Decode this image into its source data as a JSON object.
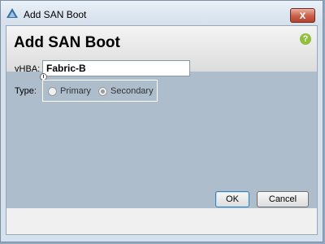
{
  "window": {
    "title": "Add SAN Boot",
    "close_label": "x"
  },
  "dialog": {
    "heading": "Add SAN Boot",
    "help_symbol": "?"
  },
  "form": {
    "vhba_label": "vHBA:",
    "vhba_value": "Fabric-B",
    "info_symbol": "i",
    "type_label": "Type:",
    "type_options": [
      {
        "label": "Primary",
        "selected": false
      },
      {
        "label": "Secondary",
        "selected": true
      }
    ]
  },
  "buttons": {
    "ok": "OK",
    "cancel": "Cancel"
  },
  "colors": {
    "panel": "#aebdcb",
    "header": "#e6e6e6",
    "help_icon": "#8fbf3c",
    "close_button": "#c95e48"
  }
}
